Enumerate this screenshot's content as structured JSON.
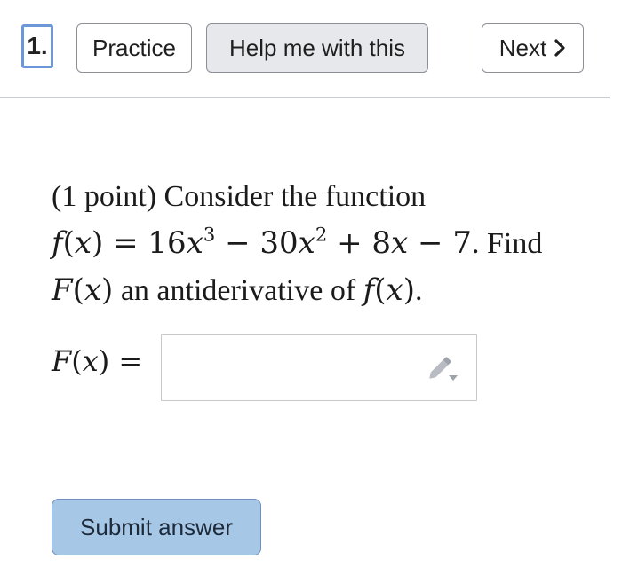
{
  "header": {
    "question_number": "1.",
    "practice_label": "Practice",
    "help_label": "Help me with this",
    "next_label": "Next",
    "next_icon": "chevron-right-icon"
  },
  "problem": {
    "points": "(1 point)",
    "intro": "Consider the function",
    "find_word": "Find",
    "tail": "an antiderivative of"
  },
  "answer": {
    "value": "",
    "edit_icon": "pencil-icon"
  },
  "submit": {
    "label": "Submit answer"
  },
  "colors": {
    "question_number_border": "#6d97d6",
    "submit_background": "#a7c7e7",
    "help_background": "#e6e8ec"
  }
}
